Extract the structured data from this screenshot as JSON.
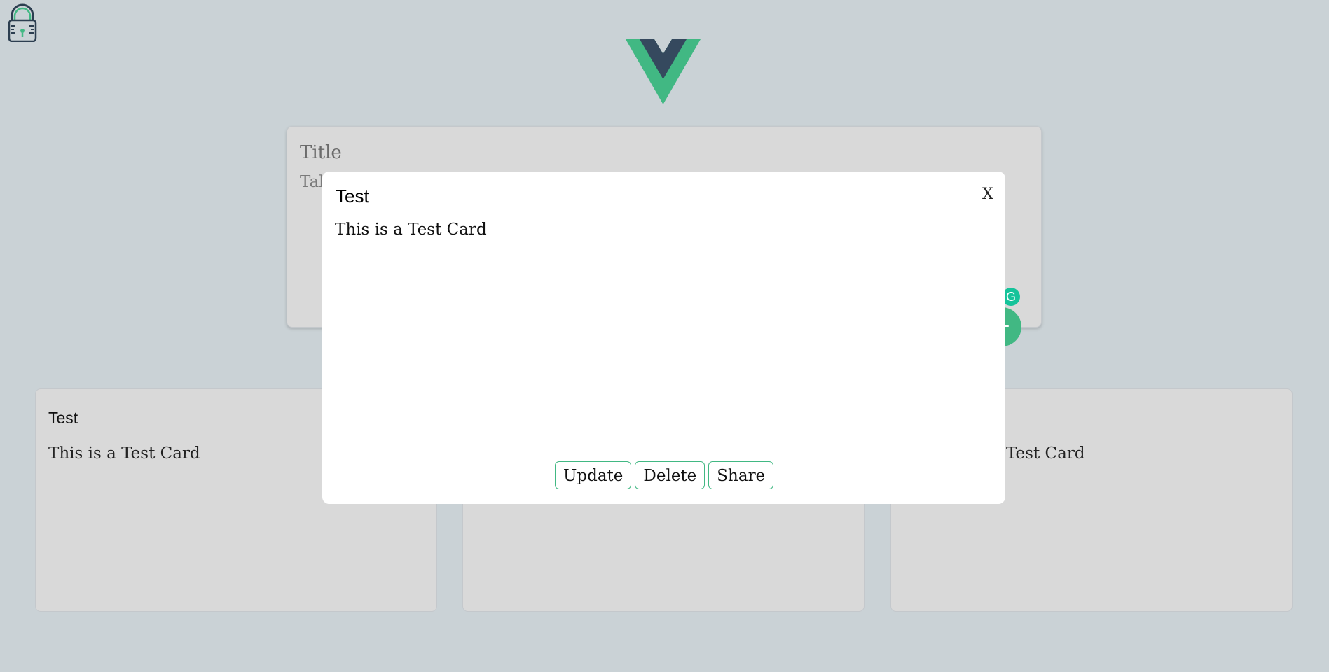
{
  "icons": {
    "lock": "lock-icon",
    "logo": "vue-logo",
    "grammarly": "G",
    "add": "+"
  },
  "colors": {
    "background": "#cad2d6",
    "accent_green": "#41b883",
    "vue_dark": "#35495e",
    "card_bg": "#d9d9d9",
    "grammarly_green": "#15c39a"
  },
  "note_form": {
    "title_placeholder": "Title",
    "body_placeholder_partial": "Tak"
  },
  "cards": [
    {
      "title": "Test",
      "body": "This is a Test Card"
    },
    {
      "title": "",
      "body": ""
    },
    {
      "title": "",
      "body": "Test Card"
    }
  ],
  "modal": {
    "title": "Test",
    "close_label": "X",
    "body": "This is a Test Card",
    "actions": {
      "update": "Update",
      "delete": "Delete",
      "share": "Share"
    }
  }
}
